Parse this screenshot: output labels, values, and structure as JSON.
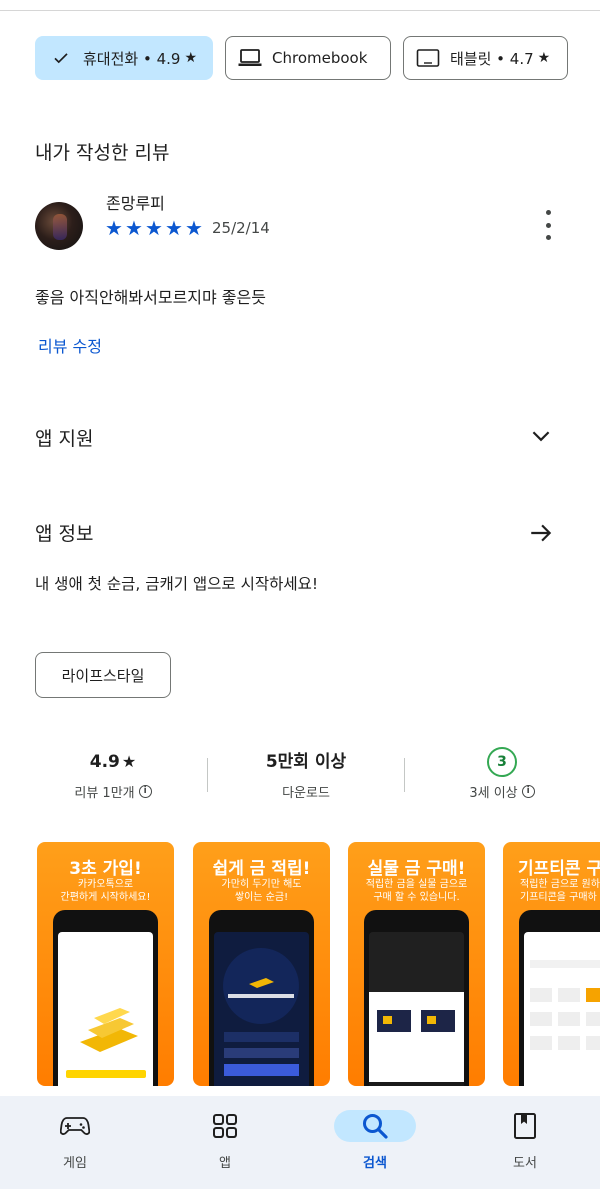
{
  "device_chips": [
    {
      "label": "휴대전화 • 4.9",
      "icon": "check-icon",
      "selected": true
    },
    {
      "label": "Chromebook",
      "icon": "laptop-icon",
      "selected": false
    },
    {
      "label": "태블릿 • 4.7",
      "icon": "tablet-icon",
      "selected": false
    }
  ],
  "my_review": {
    "heading": "내가 작성한 리뷰",
    "reviewer": "존망루피",
    "stars": 5,
    "date": "25/2/14",
    "text": "좋음 아직안해봐서모르지먀 좋은듯",
    "edit_label": "리뷰 수정"
  },
  "app_support": {
    "heading": "앱 지원"
  },
  "app_info": {
    "heading": "앱 정보",
    "description": "내 생애 첫 순금, 금캐기 앱으로 시작하세요!",
    "genre": "라이프스타일"
  },
  "stats": {
    "rating": "4.9",
    "rating_label": "리뷰 1만개",
    "downloads": "5만회 이상",
    "downloads_label": "다운로드",
    "age_badge": "3",
    "age_label": "3세 이상"
  },
  "screenshots": [
    {
      "title": "3초 가입!",
      "subtitle": "카카오톡으로\n간편하게 시작하세요!"
    },
    {
      "title": "쉽게 금 적립!",
      "subtitle": "가만히 두기만 해도\n쌓이는 순금!"
    },
    {
      "title": "실물 금 구매!",
      "subtitle": "적립한 금을 실물 금으로\n구매 할 수 있습니다."
    },
    {
      "title": "기프티콘 구",
      "subtitle": "적립한 금으로 원하\n기프티콘을 구매하"
    }
  ],
  "bottom_nav": [
    {
      "label": "게임",
      "icon": "gamepad-icon",
      "active": false
    },
    {
      "label": "앱",
      "icon": "apps-grid-icon",
      "active": false
    },
    {
      "label": "검색",
      "icon": "search-icon",
      "active": true
    },
    {
      "label": "도서",
      "icon": "book-icon",
      "active": false
    }
  ],
  "colors": {
    "accent": "#0b57d0",
    "chip_selected": "#c2e7ff",
    "screenshot_orange": "#ff8a00",
    "age_green": "#34a853"
  }
}
